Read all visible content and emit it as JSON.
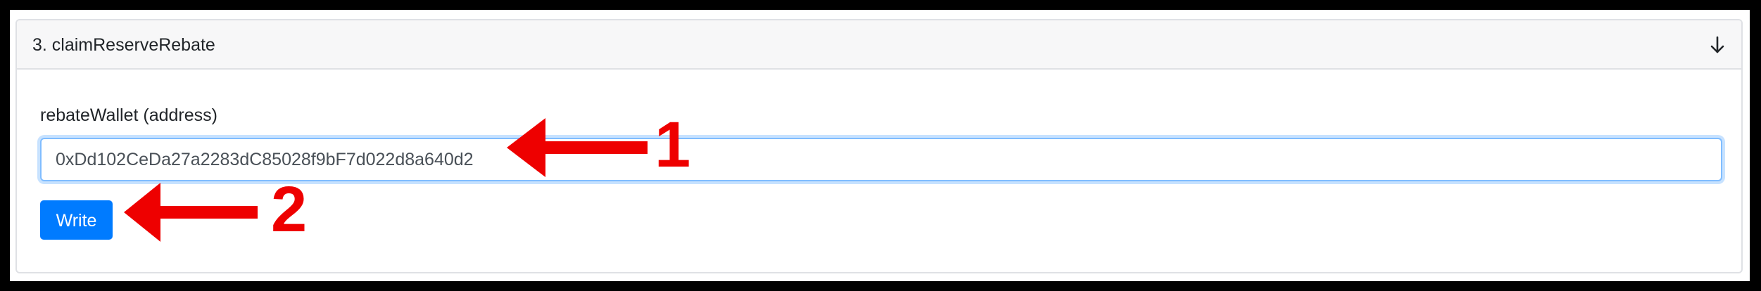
{
  "function_card": {
    "title": "3. claimReserveRebate",
    "toggle_icon": "arrow-down-icon"
  },
  "form": {
    "field_label": "rebateWallet (address)",
    "address_value": "0xDd102CeDa27a2283dC85028f9bF7d022d8a640d2",
    "write_label": "Write"
  },
  "annotations": {
    "step_one": "1",
    "step_two": "2",
    "arrow_color": "#ee0000"
  },
  "colors": {
    "primary_button": "#007bff",
    "input_focus_border": "#80bdff",
    "header_background": "#f7f7f8"
  }
}
